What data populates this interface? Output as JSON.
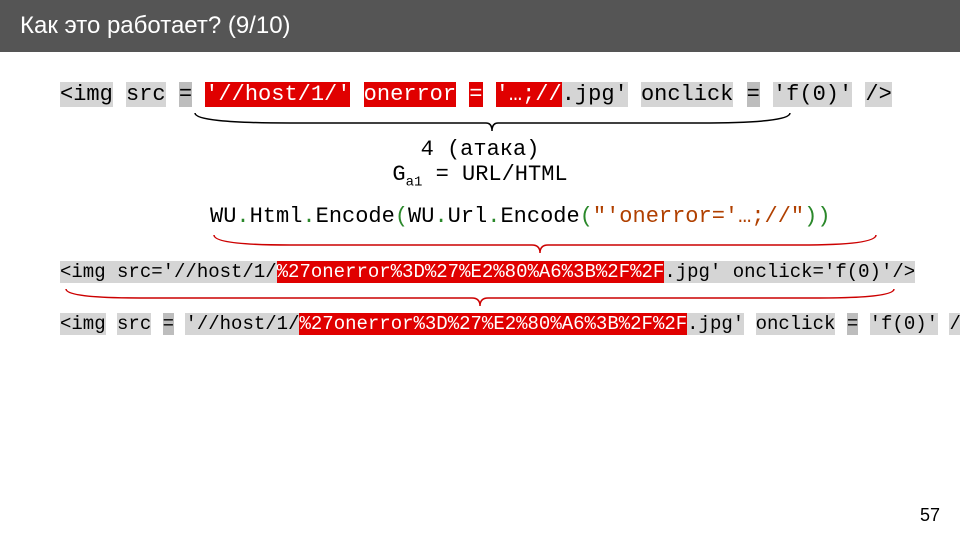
{
  "header": {
    "title": "Как это работает? (9/10)"
  },
  "line1": {
    "p1": "<img",
    "sp": " ",
    "p2": "src",
    "p3": "=",
    "p4": "'//host/1/'",
    "p5": "onerror",
    "p6": "=",
    "p7": "'…;//",
    "p8": ".jpg'",
    "p9": "onclick",
    "p10": "=",
    "p11": "'f(0)'",
    "p12": "/>"
  },
  "anno": {
    "label": "4 (атака)",
    "sub1": "G",
    "sub2": "a1",
    "sub3": " = URL/HTML"
  },
  "line2": {
    "a": "WU",
    "b": ".",
    "c": "Html",
    "d": ".",
    "e": "Encode",
    "f": "(",
    "g": "WU",
    "h": ".",
    "i": "Url",
    "j": ".",
    "k": "Encode",
    "l": "(",
    "m": "\"'onerror='…;//\"",
    "n": "))"
  },
  "line3": {
    "a": "<img src='//host/1/",
    "b": "%27onerror%3D%27%E2%80%A6%3B%2F%2F",
    "c": ".jpg' onclick='f(0)'/>"
  },
  "line4": {
    "p1": "<img",
    "p2": "src",
    "p3": "=",
    "p4a": "'//host/1/",
    "p4b": "%27onerror%3D%27%E2%80%A6%3B%2F%2F",
    "p4c": ".jpg'",
    "p5": "onclick",
    "p6": "=",
    "p7": "'f(0)'",
    "p8": "/>"
  },
  "page": "57"
}
